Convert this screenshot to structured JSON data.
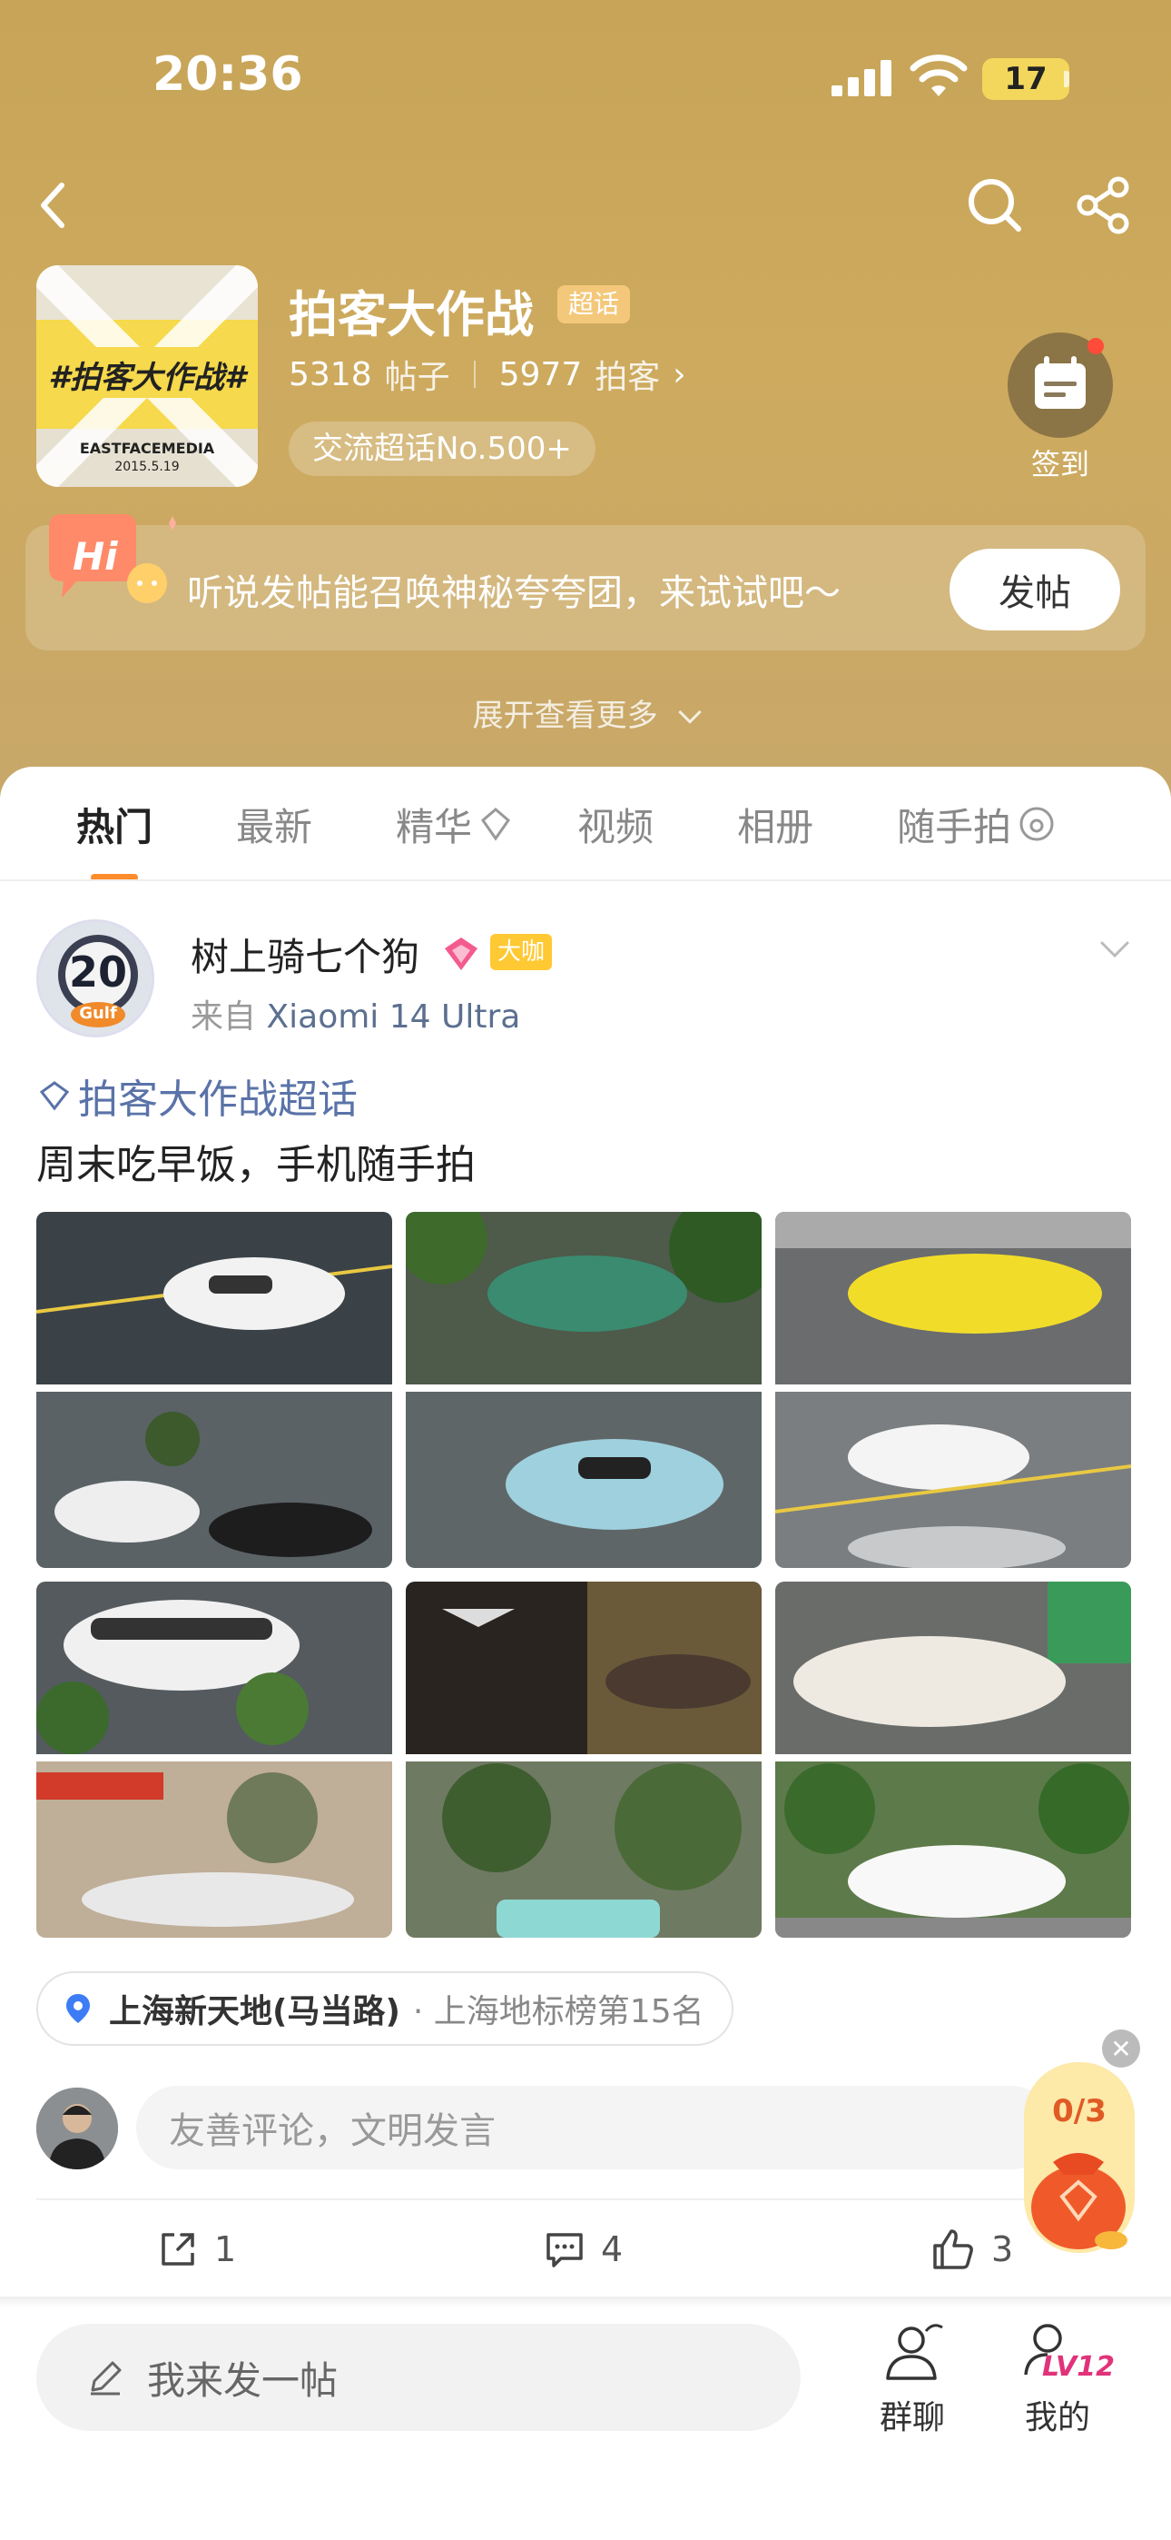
{
  "status_bar": {
    "time": "20:36",
    "battery": "17"
  },
  "topic": {
    "title": "拍客大作战",
    "badge": "超话",
    "posts_count": "5318",
    "posts_label": "帖子",
    "members_count": "5977",
    "members_label": "拍客",
    "members_chevron": "›",
    "rank_chip": "交流超话No.500+",
    "checkin_label": "签到",
    "cover_title": "#拍客大作战#",
    "cover_sub": "EASTFACEMEDIA",
    "cover_date": "2015.5.19"
  },
  "promo": {
    "text": "听说发帖能召唤神秘夸夸团，来试试吧～",
    "button": "发帖",
    "badge_text": "Hi"
  },
  "expand_more": "展开查看更多",
  "tabs": [
    {
      "label": "热门"
    },
    {
      "label": "最新"
    },
    {
      "label": "精华"
    },
    {
      "label": "视频"
    },
    {
      "label": "相册"
    },
    {
      "label": "随手拍"
    }
  ],
  "post": {
    "username": "树上骑七个狗",
    "level_badge": "大咖",
    "from_prefix": "来自",
    "device": "Xiaomi 14 Ultra",
    "avatar_number": "20",
    "avatar_brand": "Gulf",
    "topic_tag": "拍客大作战超话",
    "text": "周末吃早饭，手机随手拍",
    "location_name": "上海新天地(马当路)",
    "location_extra": "· 上海地标榜第15名",
    "comment_placeholder": "友善评论，文明发言",
    "repost_count": "1",
    "comment_count": "4",
    "like_count": "3"
  },
  "reward": {
    "count": "0/3"
  },
  "bottom_bar": {
    "write_placeholder": "我来发一帖",
    "group_chat": "群聊",
    "mine": "我的",
    "level": "LV12"
  },
  "colors": {
    "header_gold": "#c9a75c",
    "accent_orange": "#ff8c2a",
    "link_blue": "#5a73a8"
  }
}
